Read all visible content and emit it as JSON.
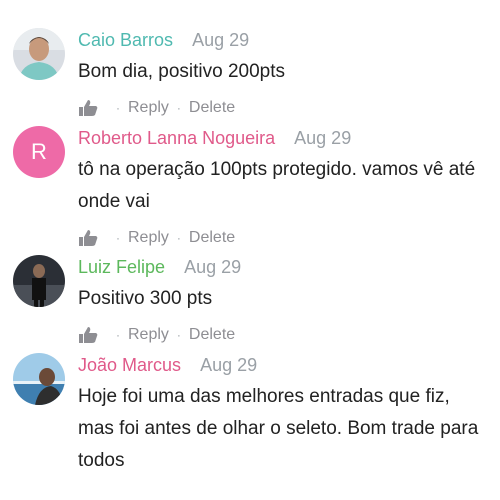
{
  "comments": [
    {
      "author": "Caio Barros",
      "author_color": "#4fb9b0",
      "date": "Aug 29",
      "text": "Bom dia, positivo 200pts",
      "avatar": "photo",
      "reply_label": "Reply",
      "delete_label": "Delete",
      "separator": "·"
    },
    {
      "author": "Roberto Lanna Nogueira",
      "author_color": "#e05a8a",
      "date": "Aug 29",
      "text": "tô na operação 100pts protegido. vamos vê até onde vai",
      "avatar": "letter",
      "avatar_letter": "R",
      "avatar_color": "#ee6aa7",
      "reply_label": "Reply",
      "delete_label": "Delete",
      "separator": "·"
    },
    {
      "author": "Luiz Felipe",
      "author_color": "#5cb85c",
      "date": "Aug 29",
      "text": "Positivo 300 pts",
      "avatar": "photo",
      "reply_label": "Reply",
      "delete_label": "Delete",
      "separator": "·"
    },
    {
      "author": "João Marcus",
      "author_color": "#e05a8a",
      "date": "Aug 29",
      "text": "Hoje foi uma das melhores entradas que fiz, mas foi antes de olhar o seleto. Bom trade para todos",
      "avatar": "photo",
      "reply_label": "Reply",
      "delete_label": "Delete",
      "separator": "·"
    }
  ]
}
